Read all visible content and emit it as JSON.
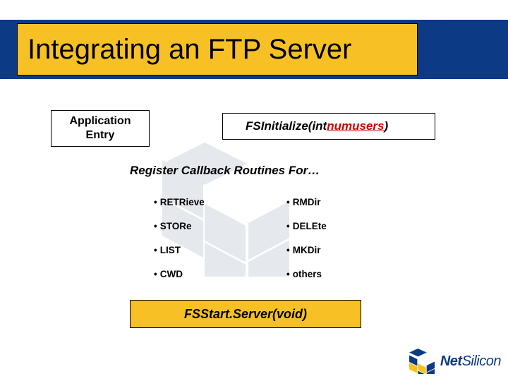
{
  "title": "Integrating an FTP Server",
  "boxes": {
    "app_entry": "Application\nEntry",
    "fs_init_prefix": "FSInitialize(int ",
    "fs_init_param": "numusers",
    "fs_init_suffix": ")",
    "fs_start": "FSStart.Server(void)"
  },
  "subheading": "Register Callback Routines For…",
  "bullets_left": [
    "RETRieve",
    "STORe",
    "LIST",
    "CWD"
  ],
  "bullets_right": [
    "RMDir",
    "DELEte",
    "MKDir",
    "others"
  ],
  "footer": {
    "brand1": "Net",
    "brand2": "Silicon"
  }
}
